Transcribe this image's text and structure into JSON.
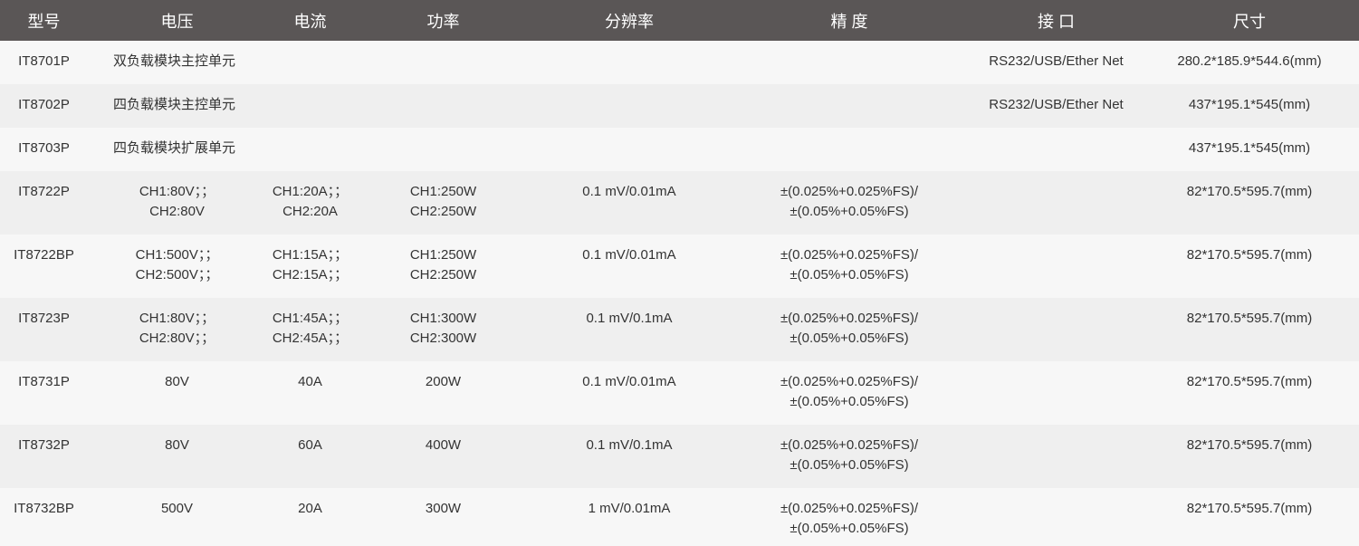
{
  "header": {
    "model": "型号",
    "voltage": "电压",
    "current": "电流",
    "power": "功率",
    "resolution": "分辨率",
    "accuracy": "精 度",
    "interface": "接 口",
    "size": "尺寸"
  },
  "rows": [
    {
      "model": "IT8701P",
      "description": "双负载模块主控单元",
      "interface": "RS232/USB/Ether Net",
      "size": "280.2*185.9*544.6(mm)"
    },
    {
      "model": "IT8702P",
      "description": "四负载模块主控单元",
      "interface": "RS232/USB/Ether Net",
      "size": "437*195.1*545(mm)"
    },
    {
      "model": "IT8703P",
      "description": "四负载模块扩展单元",
      "interface": "",
      "size": "437*195.1*545(mm)"
    },
    {
      "model": "IT8722P",
      "voltage": [
        "CH1:80V；；",
        "CH2:80V"
      ],
      "current": [
        "CH1:20A；；",
        "CH2:20A"
      ],
      "power": [
        "CH1:250W",
        "CH2:250W"
      ],
      "resolution": "0.1 mV/0.01mA",
      "accuracy": [
        "±(0.025%+0.025%FS)/",
        "±(0.05%+0.05%FS)"
      ],
      "interface": "",
      "size": "82*170.5*595.7(mm)"
    },
    {
      "model": "IT8722BP",
      "voltage": [
        "CH1:500V；；",
        "CH2:500V；；"
      ],
      "current": [
        "CH1:15A；；",
        "CH2:15A；；"
      ],
      "power": [
        "CH1:250W",
        "CH2:250W"
      ],
      "resolution": "0.1 mV/0.01mA",
      "accuracy": [
        "±(0.025%+0.025%FS)/",
        "±(0.05%+0.05%FS)"
      ],
      "interface": "",
      "size": "82*170.5*595.7(mm)"
    },
    {
      "model": "IT8723P",
      "voltage": [
        "CH1:80V；；",
        "CH2:80V；；"
      ],
      "current": [
        "CH1:45A；；",
        "CH2:45A；；"
      ],
      "power": [
        "CH1:300W",
        "CH2:300W"
      ],
      "resolution": "0.1 mV/0.1mA",
      "accuracy": [
        "±(0.025%+0.025%FS)/",
        "±(0.05%+0.05%FS)"
      ],
      "interface": "",
      "size": "82*170.5*595.7(mm)"
    },
    {
      "model": "IT8731P",
      "voltage": [
        "80V"
      ],
      "current": [
        "40A"
      ],
      "power": [
        "200W"
      ],
      "resolution": "0.1 mV/0.01mA",
      "accuracy": [
        "±(0.025%+0.025%FS)/",
        "±(0.05%+0.05%FS)"
      ],
      "interface": "",
      "size": "82*170.5*595.7(mm)"
    },
    {
      "model": "IT8732P",
      "voltage": [
        "80V"
      ],
      "current": [
        "60A"
      ],
      "power": [
        "400W"
      ],
      "resolution": "0.1 mV/0.1mA",
      "accuracy": [
        "±(0.025%+0.025%FS)/",
        "±(0.05%+0.05%FS)"
      ],
      "interface": "",
      "size": "82*170.5*595.7(mm)"
    },
    {
      "model": "IT8732BP",
      "voltage": [
        "500V"
      ],
      "current": [
        "20A"
      ],
      "power": [
        "300W"
      ],
      "resolution": "1 mV/0.01mA",
      "accuracy": [
        "±(0.025%+0.025%FS)/",
        "±(0.05%+0.05%FS)"
      ],
      "interface": "",
      "size": "82*170.5*595.7(mm)"
    }
  ]
}
